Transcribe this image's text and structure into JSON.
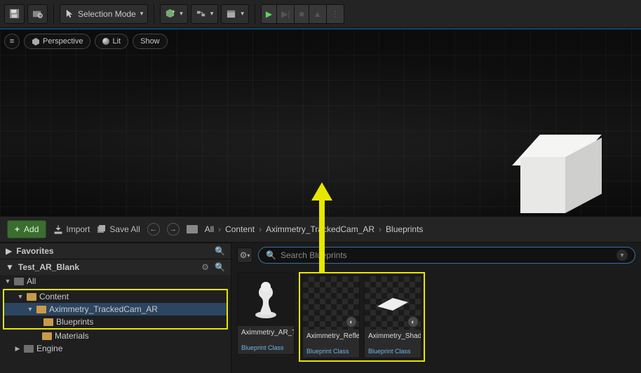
{
  "toolbar": {
    "selection_mode": "Selection Mode"
  },
  "viewport": {
    "perspective": "Perspective",
    "lit": "Lit",
    "show": "Show"
  },
  "cb": {
    "add": "Add",
    "import": "Import",
    "save_all": "Save All",
    "crumbs": [
      "All",
      "Content",
      "Aximmetry_TrackedCam_AR",
      "Blueprints"
    ]
  },
  "left": {
    "favorites": "Favorites",
    "project": "Test_AR_Blank",
    "tree": {
      "all": "All",
      "content": "Content",
      "tracked": "Aximmetry_TrackedCam_AR",
      "blueprints": "Blueprints",
      "materials": "Materials",
      "engine": "Engine"
    }
  },
  "right": {
    "search_placeholder": "Search Blueprints",
    "asset_type": "Blueprint Class",
    "assets": [
      {
        "name": "Aximmetry_AR_Tracked_"
      },
      {
        "name": "Aximmetry_Reflection_"
      },
      {
        "name": "Aximmetry_Shadow_"
      }
    ]
  }
}
